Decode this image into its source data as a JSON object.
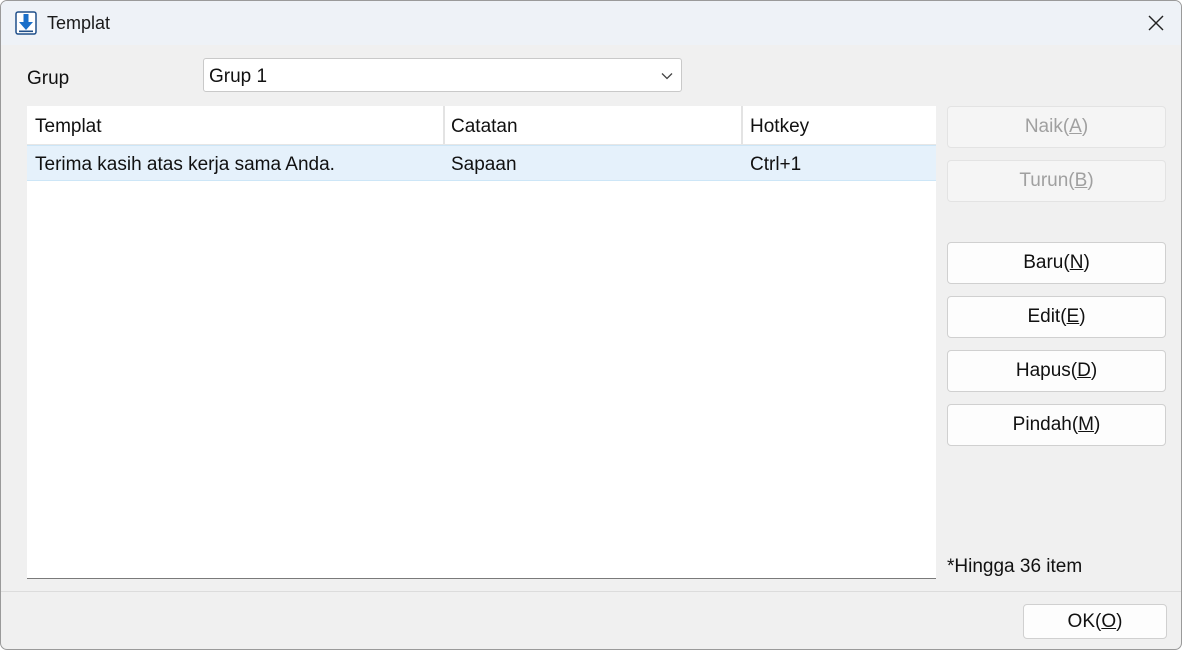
{
  "window": {
    "title": "Templat",
    "icon": "download-arrow-icon"
  },
  "group": {
    "label": "Grup",
    "selected": "Grup 1"
  },
  "list": {
    "columns": [
      "Templat",
      "Catatan",
      "Hotkey"
    ],
    "rows": [
      {
        "template": "Terima kasih atas kerja sama Anda.",
        "note": "Sapaan",
        "hotkey": "Ctrl+1",
        "selected": true
      }
    ]
  },
  "buttons": {
    "up": {
      "text": "Naik(",
      "key": "A",
      "end": ")",
      "enabled": false
    },
    "down": {
      "text": "Turun(",
      "key": "B",
      "end": ")",
      "enabled": false
    },
    "new": {
      "text": "Baru(",
      "key": "N",
      "end": ")",
      "enabled": true
    },
    "edit": {
      "text": "Edit(",
      "key": "E",
      "end": ")",
      "enabled": true
    },
    "delete": {
      "text": "Hapus(",
      "key": "D",
      "end": ")",
      "enabled": true
    },
    "move": {
      "text": "Pindah(",
      "key": "M",
      "end": ")",
      "enabled": true
    },
    "ok": {
      "text": "OK(",
      "key": "O",
      "end": ")",
      "enabled": true
    }
  },
  "limit_note": "*Hingga 36 item",
  "colors": {
    "selection_bg": "#e5f1fb",
    "icon_blue": "#1a6fc9",
    "disabled_text": "#a0a0a0"
  }
}
